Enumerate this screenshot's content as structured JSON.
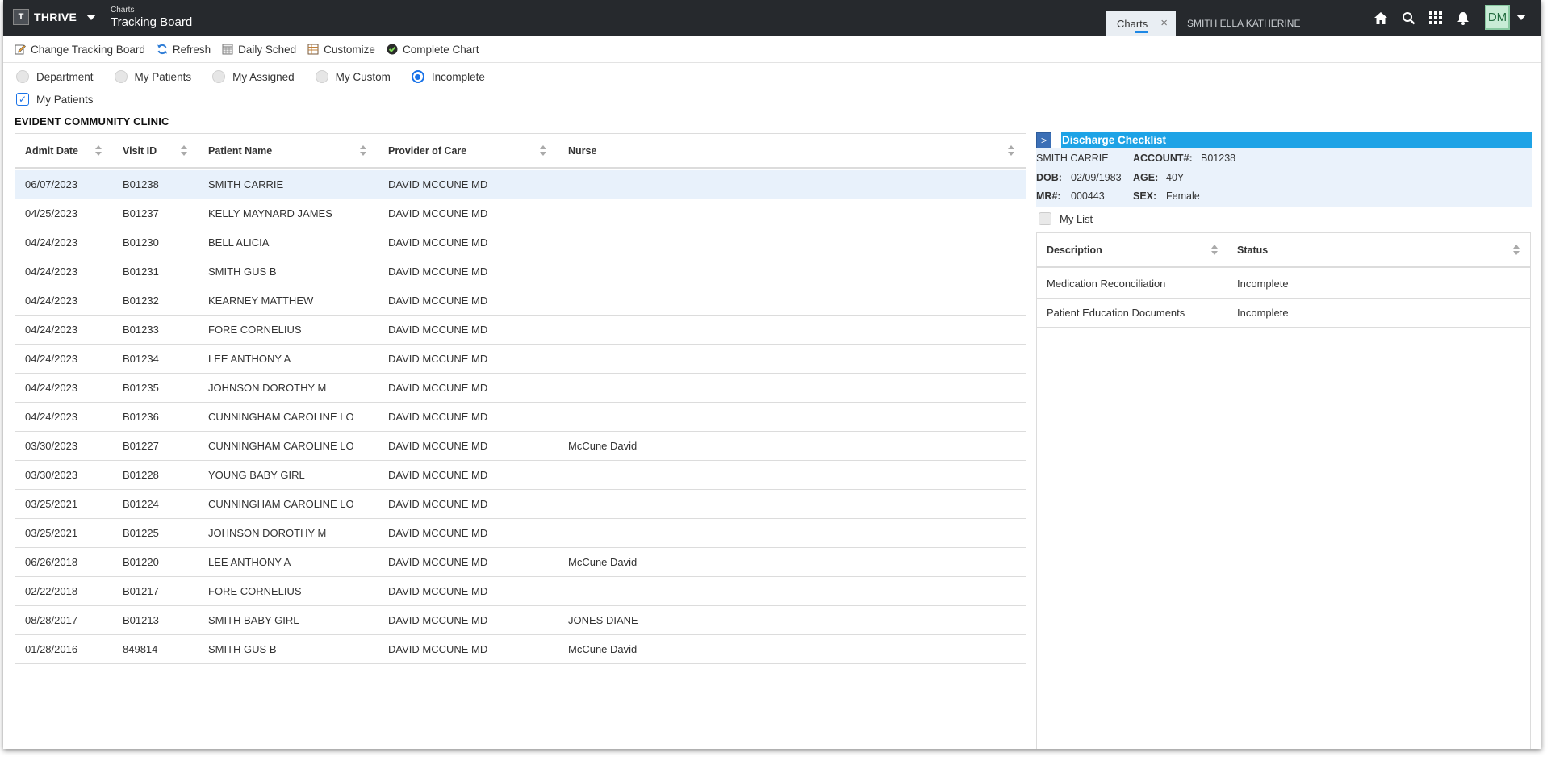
{
  "topbar": {
    "logo": "T",
    "brand": "THRIVE",
    "app_sup": "Charts",
    "app_title": "Tracking Board",
    "tab_charts": "Charts",
    "tab_close": "×",
    "tab_patient": "SMITH ELLA KATHERINE",
    "avatar": "DM"
  },
  "toolbar": {
    "change": "Change Tracking Board",
    "refresh": "Refresh",
    "daily": "Daily Sched",
    "customize": "Customize",
    "complete": "Complete Chart"
  },
  "filters": {
    "options": [
      "Department",
      "My Patients",
      "My Assigned",
      "My Custom",
      "Incomplete"
    ],
    "selected": "Incomplete",
    "my_patients_checkbox": "My Patients",
    "my_patients_checked": true
  },
  "clinic": "EVIDENT COMMUNITY CLINIC",
  "table": {
    "columns": [
      "Admit Date",
      "Visit ID",
      "Patient Name",
      "Provider of Care",
      "Nurse"
    ],
    "rows": [
      [
        "06/07/2023",
        "B01238",
        "SMITH CARRIE",
        "DAVID MCCUNE MD",
        ""
      ],
      [
        "04/25/2023",
        "B01237",
        "KELLY MAYNARD JAMES",
        "DAVID MCCUNE MD",
        ""
      ],
      [
        "04/24/2023",
        "B01230",
        "BELL ALICIA",
        "DAVID MCCUNE MD",
        ""
      ],
      [
        "04/24/2023",
        "B01231",
        "SMITH GUS B",
        "DAVID MCCUNE MD",
        ""
      ],
      [
        "04/24/2023",
        "B01232",
        "KEARNEY MATTHEW",
        "DAVID MCCUNE MD",
        ""
      ],
      [
        "04/24/2023",
        "B01233",
        "FORE CORNELIUS",
        "DAVID MCCUNE MD",
        ""
      ],
      [
        "04/24/2023",
        "B01234",
        "LEE ANTHONY A",
        "DAVID MCCUNE MD",
        ""
      ],
      [
        "04/24/2023",
        "B01235",
        "JOHNSON DOROTHY M",
        "DAVID MCCUNE MD",
        ""
      ],
      [
        "04/24/2023",
        "B01236",
        "CUNNINGHAM CAROLINE LO",
        "DAVID MCCUNE MD",
        ""
      ],
      [
        "03/30/2023",
        "B01227",
        "CUNNINGHAM CAROLINE LO",
        "DAVID MCCUNE MD",
        "McCune David"
      ],
      [
        "03/30/2023",
        "B01228",
        "YOUNG BABY GIRL",
        "DAVID MCCUNE MD",
        ""
      ],
      [
        "03/25/2021",
        "B01224",
        "CUNNINGHAM CAROLINE LO",
        "DAVID MCCUNE MD",
        ""
      ],
      [
        "03/25/2021",
        "B01225",
        "JOHNSON DOROTHY M",
        "DAVID MCCUNE MD",
        ""
      ],
      [
        "06/26/2018",
        "B01220",
        "LEE ANTHONY A",
        "DAVID MCCUNE MD",
        "McCune David"
      ],
      [
        "02/22/2018",
        "B01217",
        "FORE CORNELIUS",
        "DAVID MCCUNE MD",
        ""
      ],
      [
        "08/28/2017",
        "B01213",
        "SMITH BABY GIRL",
        "DAVID MCCUNE MD",
        "JONES DIANE"
      ],
      [
        "01/28/2016",
        "849814",
        "SMITH GUS B",
        "DAVID MCCUNE MD",
        "McCune David"
      ]
    ],
    "selected_row": 0
  },
  "discharge": {
    "toggle": ">",
    "title": "Discharge Checklist",
    "patient_name": "SMITH CARRIE",
    "account_label": "ACCOUNT#:",
    "account": "B01238",
    "dob_label": "DOB:",
    "dob": "02/09/1983",
    "age_label": "AGE:",
    "age": "40Y",
    "mr_label": "MR#:",
    "mr": "000443",
    "sex_label": "SEX:",
    "sex": "Female",
    "my_list": "My List",
    "columns": [
      "Description",
      "Status"
    ],
    "rows": [
      [
        "Medication Reconciliation",
        "Incomplete"
      ],
      [
        "Patient Education Documents",
        "Incomplete"
      ]
    ]
  },
  "colors": {
    "topbar": "#26292d",
    "accent": "#1a73e8",
    "checklist_header": "#1ea3e6",
    "selected_row": "#e8f1fb"
  }
}
